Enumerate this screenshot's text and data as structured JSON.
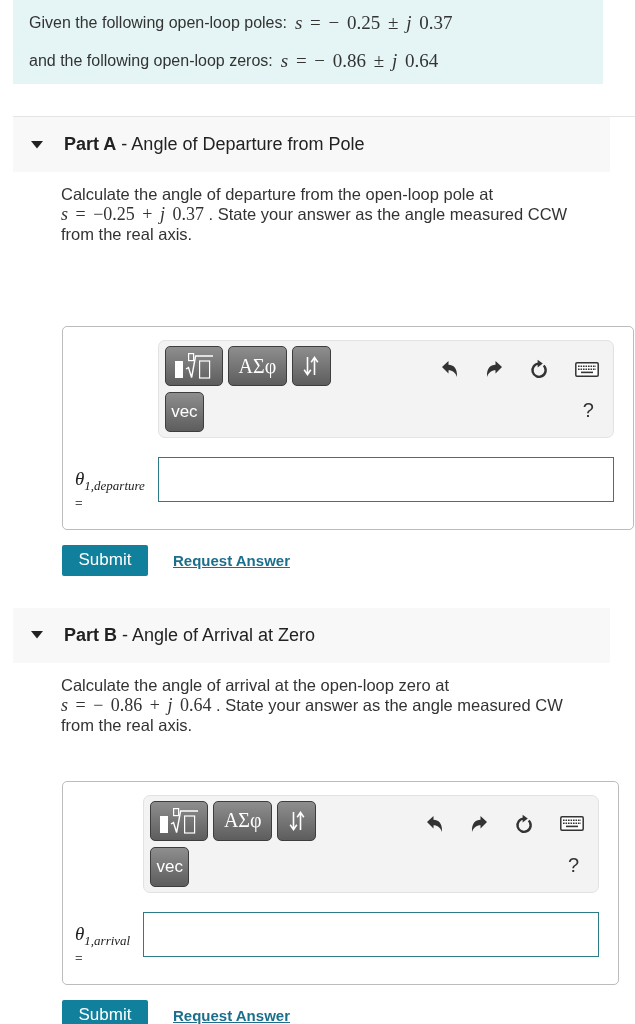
{
  "given": [
    {
      "text": "Given the following open-loop poles:",
      "math": "*s* = − 0.25 ± *j* 0.37"
    },
    {
      "text": "and the following open-loop zeros:",
      "math": "*s* = − 0.86  ± *j* 0.64"
    }
  ],
  "parts": [
    {
      "expanded": true,
      "heading": "**Part A** - Angle of Departure from Pole",
      "question": [
        {
          "kind": "text",
          "text": "Calculate the angle of departure from the open-loop pole at"
        },
        {
          "kind": "math",
          "text": "*s* = −0.25  + *j* 0.37"
        },
        {
          "kind": "text",
          "text": ". State your answer as the angle measured CCW from the real axis."
        }
      ],
      "toolbar": {
        "symbols_button": "ΑΣφ",
        "vector_button": "vec",
        "help": "?"
      },
      "answer": {
        "label": "θ$_{1,departure}$",
        "equals": "="
      },
      "submit": "Submit",
      "request_answer": "Request Answer"
    },
    {
      "expanded": true,
      "heading": "**Part B** - Angle of Arrival at Zero",
      "question": [
        {
          "kind": "text",
          "text": "Calculate the angle of arrival at the open-loop zero at"
        },
        {
          "kind": "math",
          "text": "*s* = − 0.86 + *j* 0.64"
        },
        {
          "kind": "text",
          "text": ". State your answer as the angle measured CW from the real axis."
        }
      ],
      "toolbar": {
        "symbols_button": "ΑΣφ",
        "vector_button": "vec",
        "help": "?"
      },
      "answer": {
        "label": "θ$_{1,arrival}$",
        "equals": "="
      },
      "submit": "Submit",
      "request_answer": "Request Answer"
    }
  ]
}
